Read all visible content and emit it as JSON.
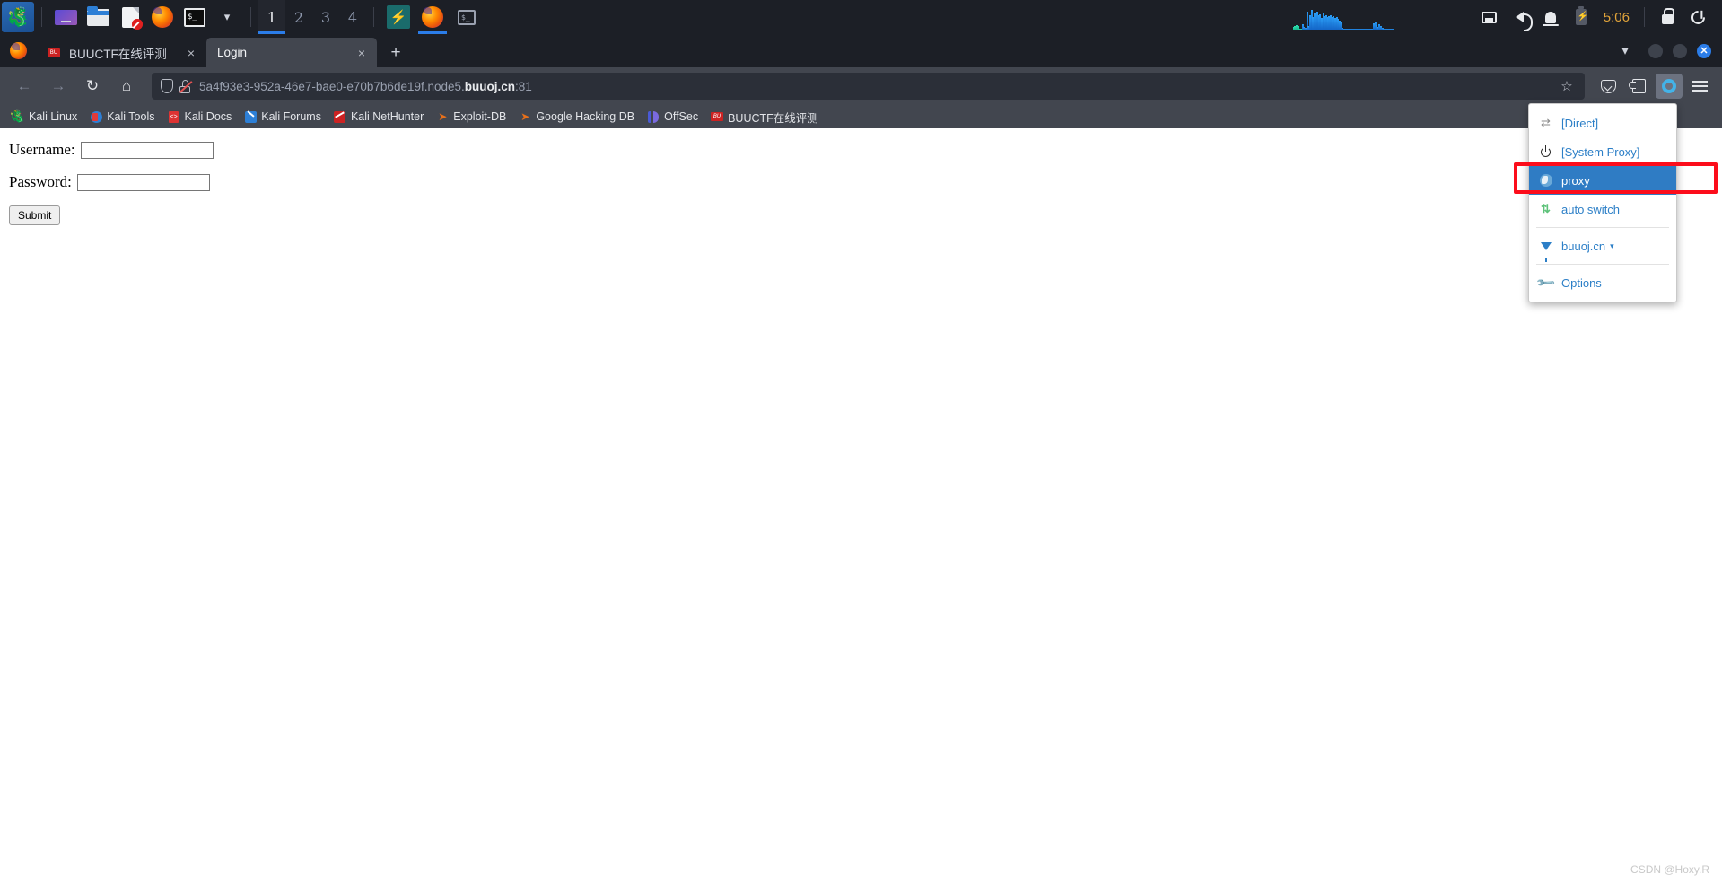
{
  "desktop_panel": {
    "launchers": [
      {
        "name": "kali-menu",
        "icon": "kali-dragon-icon"
      },
      {
        "name": "files-launcher",
        "icon": "files-icon"
      },
      {
        "name": "file-manager-launcher",
        "icon": "folder-icon"
      },
      {
        "name": "text-editor-launcher",
        "icon": "document-icon"
      },
      {
        "name": "firefox-launcher",
        "icon": "firefox-icon"
      },
      {
        "name": "terminal-launcher",
        "icon": "terminal-icon"
      },
      {
        "name": "launcher-chevron",
        "icon": "chevron-down-icon"
      }
    ],
    "workspaces": [
      {
        "label": "1",
        "active": true
      },
      {
        "label": "2",
        "active": false
      },
      {
        "label": "3",
        "active": false
      },
      {
        "label": "4",
        "active": false
      }
    ],
    "tasks": [
      {
        "name": "burpsuite-task",
        "icon": "burp-icon",
        "active": false
      },
      {
        "name": "firefox-task",
        "icon": "firefox-icon",
        "active": true
      },
      {
        "name": "terminal-task",
        "icon": "terminal-icon",
        "active": false
      }
    ],
    "tray": {
      "network_icon": "network-icon",
      "volume_icon": "volume-icon",
      "notification_icon": "bell-icon",
      "battery_icon": "battery-charging-icon",
      "clock": "5:06",
      "lock_icon": "lock-icon",
      "logout_icon": "power-logout-icon"
    }
  },
  "browser": {
    "tabs": [
      {
        "title": "BUUCTF在线评测",
        "favicon": "buuctf-favicon",
        "active": false,
        "close_label": "×"
      },
      {
        "title": "Login",
        "favicon": "",
        "active": true,
        "close_label": "×"
      }
    ],
    "new_tab_label": "+",
    "list_all_tabs_label": "⌄",
    "window_controls": {
      "minimize": "",
      "maximize": "",
      "close": "✕"
    },
    "nav": {
      "back_label": "←",
      "forward_label": "→",
      "reload_label": "↻",
      "home_label": "⌂"
    },
    "url": {
      "prefix": "5a4f93e3-952a-46e7-bae0-e70b7b6de19f.node5.",
      "domain": "buuoj.cn",
      "suffix": ":81",
      "full": "5a4f93e3-952a-46e7-bae0-e70b7b6de19f.node5.buuoj.cn:81",
      "shield_icon": "tracking-protection-shield-icon",
      "lock_icon": "insecure-connection-icon",
      "bookmark_star_label": "☆"
    },
    "toolbar_right": [
      {
        "name": "pocket-button",
        "icon": "pocket-icon"
      },
      {
        "name": "extensions-button",
        "icon": "extensions-icon"
      },
      {
        "name": "switchyomega-button",
        "icon": "omega-ring-icon"
      },
      {
        "name": "app-menu-button",
        "icon": "hamburger-icon"
      }
    ],
    "bookmarks": [
      {
        "label": "Kali Linux",
        "icon": "kali-dragon-icon"
      },
      {
        "label": "Kali Tools",
        "icon": "kali-tools-icon"
      },
      {
        "label": "Kali Docs",
        "icon": "kali-docs-icon"
      },
      {
        "label": "Kali Forums",
        "icon": "kali-forums-icon"
      },
      {
        "label": "Kali NetHunter",
        "icon": "kali-nethunter-icon"
      },
      {
        "label": "Exploit-DB",
        "icon": "exploit-db-icon"
      },
      {
        "label": "Google Hacking DB",
        "icon": "exploit-db-icon"
      },
      {
        "label": "OffSec",
        "icon": "offsec-icon"
      },
      {
        "label": "BUUCTF在线评测",
        "icon": "buuctf-favicon"
      }
    ]
  },
  "page": {
    "username_label": "Username:",
    "username_value": "",
    "password_label": "Password:",
    "password_value": "",
    "submit_label": "Submit",
    "watermark": "CSDN @Hoxy.R"
  },
  "omega_menu": {
    "items": [
      {
        "label": "[Direct]",
        "icon": "direct-arrows-icon",
        "selected": false,
        "caret": false
      },
      {
        "label": "[System Proxy]",
        "icon": "power-icon",
        "selected": false,
        "caret": false
      },
      {
        "label": "proxy",
        "icon": "globe-icon",
        "selected": true,
        "caret": false
      },
      {
        "label": "auto switch",
        "icon": "switch-arrows-icon",
        "selected": false,
        "caret": false
      },
      {
        "label": "buuoj.cn",
        "icon": "funnel-icon",
        "selected": false,
        "caret": true
      },
      {
        "label": "Options",
        "icon": "wrench-icon",
        "selected": false,
        "caret": false
      }
    ],
    "caret_glyph": "▾"
  },
  "annotation": {
    "highlight_color": "#fc0d1b",
    "target": "proxy"
  },
  "colors": {
    "panel_bg": "#1c1f26",
    "chrome_bg": "#42464f",
    "urlbar_bg": "#2b2f38",
    "accent_blue": "#2b7de9",
    "menu_selected": "#2f7cc4",
    "menu_link": "#2c7fc7",
    "clock": "#e0a33a"
  }
}
